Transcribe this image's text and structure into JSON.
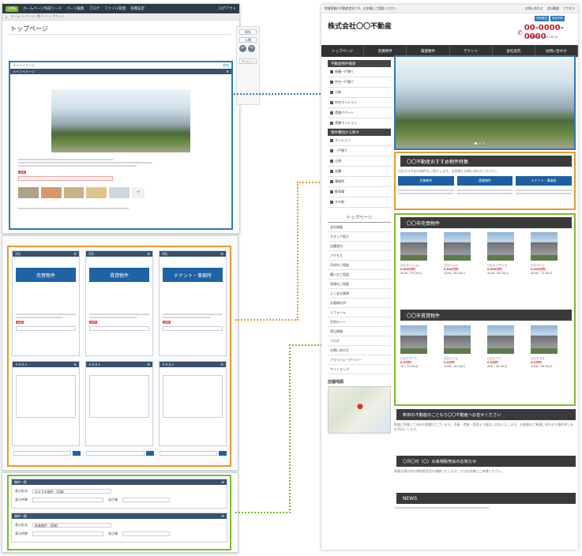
{
  "editor": {
    "app_label": "CMS",
    "window_title": "ホームページ作成ツール",
    "menu": [
      "ページ編集",
      "ブログ",
      "ファイル管理",
      "各種設定"
    ],
    "user_label": "ログアウト",
    "breadcrumb": "ホーム > ページ一覧 > トップページ",
    "page_title": "トップページ",
    "side_buttons": [
      "保存",
      "公開",
      "プレビュー"
    ],
    "main_widget_title": "メインイメージ",
    "add_label": "追加",
    "column_titles": [
      "1列",
      "2列",
      "3列"
    ],
    "column_buttons": [
      "売買物件",
      "賃貸物件",
      "テナント・事務所"
    ],
    "text_widget_title": "テキスト",
    "property_widget_title": "物件一覧",
    "property_rows": [
      {
        "label": "表示形式",
        "value": "おすすめ物件（売買）"
      },
      {
        "label": "表示形式",
        "value": "新着物件（賃貸）"
      }
    ],
    "select_labels": [
      "表示件数",
      "並び順"
    ]
  },
  "site": {
    "tagline": "地域密着の不動産会社です。お気軽にご相談ください",
    "top_links": [
      "お問い合わせ",
      "会社概要",
      "アクセス"
    ],
    "top_btns": [
      "売却査定",
      "来店予約"
    ],
    "company": "株式会社〇〇不動産",
    "phone": "00-0000-0000",
    "hours": "営業時間 9:00-18:00",
    "nav": [
      "トップページ",
      "売買物件",
      "賃貸物件",
      "テナント",
      "会社案内",
      "お問い合わせ"
    ],
    "side_head1": "不動産物件検索",
    "side_items1": [
      "新築一戸建て",
      "中古一戸建て",
      "土地",
      "中古マンション",
      "賃貸アパート",
      "賃貸マンション"
    ],
    "side_head2": "物件種別から探す",
    "side_items2": [
      "マンション",
      "一戸建て",
      "土地",
      "店舗",
      "事務所",
      "駐車場",
      "その他"
    ],
    "side_menu_title": "トップページ",
    "side_menu_items": [
      "会社概要",
      "スタッフ紹介",
      "店舗案内",
      "アクセス",
      "売却のご相談",
      "購入のご相談",
      "賃貸のご相談",
      "よくある質問",
      "お客様の声",
      "リフォーム",
      "住宅ローン",
      "周辺情報",
      "ブログ",
      "お問い合わせ",
      "プライバシーポリシー",
      "サイトマップ"
    ],
    "map_title": "店舗地図",
    "section1": "〇〇不動産おすすめ物件特集",
    "section1_text": "当社おすすめの物件をご紹介します。お気軽にお問い合わせください。",
    "section1_btns": [
      "売買物件",
      "賃貸物件",
      "テナント・事務所"
    ],
    "section2": "〇〇市売買物件",
    "section3": "〇〇市賃貸物件",
    "props": [
      {
        "name": "〇〇マンション",
        "price": "0,000万円",
        "spec": "3LDK / 70.00㎡"
      },
      {
        "name": "〇〇ハイツ",
        "price": "0,000万円",
        "spec": "2LDK / 60.00㎡"
      },
      {
        "name": "〇〇レジデンス",
        "price": "0,000万円",
        "spec": "4LDK / 85.00㎡"
      },
      {
        "name": "〇〇コート",
        "price": "0,000万円",
        "spec": "3LDK / 72.00㎡"
      }
    ],
    "rent": [
      {
        "name": "〇〇アパート",
        "price": "0.0万円",
        "spec": "1K / 25.00㎡"
      },
      {
        "name": "〇〇ハイム",
        "price": "0.0万円",
        "spec": "1LDK / 40.00㎡"
      },
      {
        "name": "〇〇メゾン",
        "price": "0.0万円",
        "spec": "2DK / 45.00㎡"
      },
      {
        "name": "〇〇テラス",
        "price": "0.0万円",
        "spec": "2LDK / 55.00㎡"
      }
    ],
    "section4": "新田の不動産のことなら〇〇不動産へお任せください",
    "section4_text": "地域に密着して長年の実績がございます。売買・賃貸・管理まで幅広く対応いたします。お客様のご希望に合わせた物件探しをお手伝いします。",
    "section5": "〇月〇日（〇）の来場販売会のお知らせ",
    "section5_text": "新築分譲住宅の現地販売会を開催いたします。ぜひお気軽にご来場ください。",
    "section6": "NEWS"
  }
}
